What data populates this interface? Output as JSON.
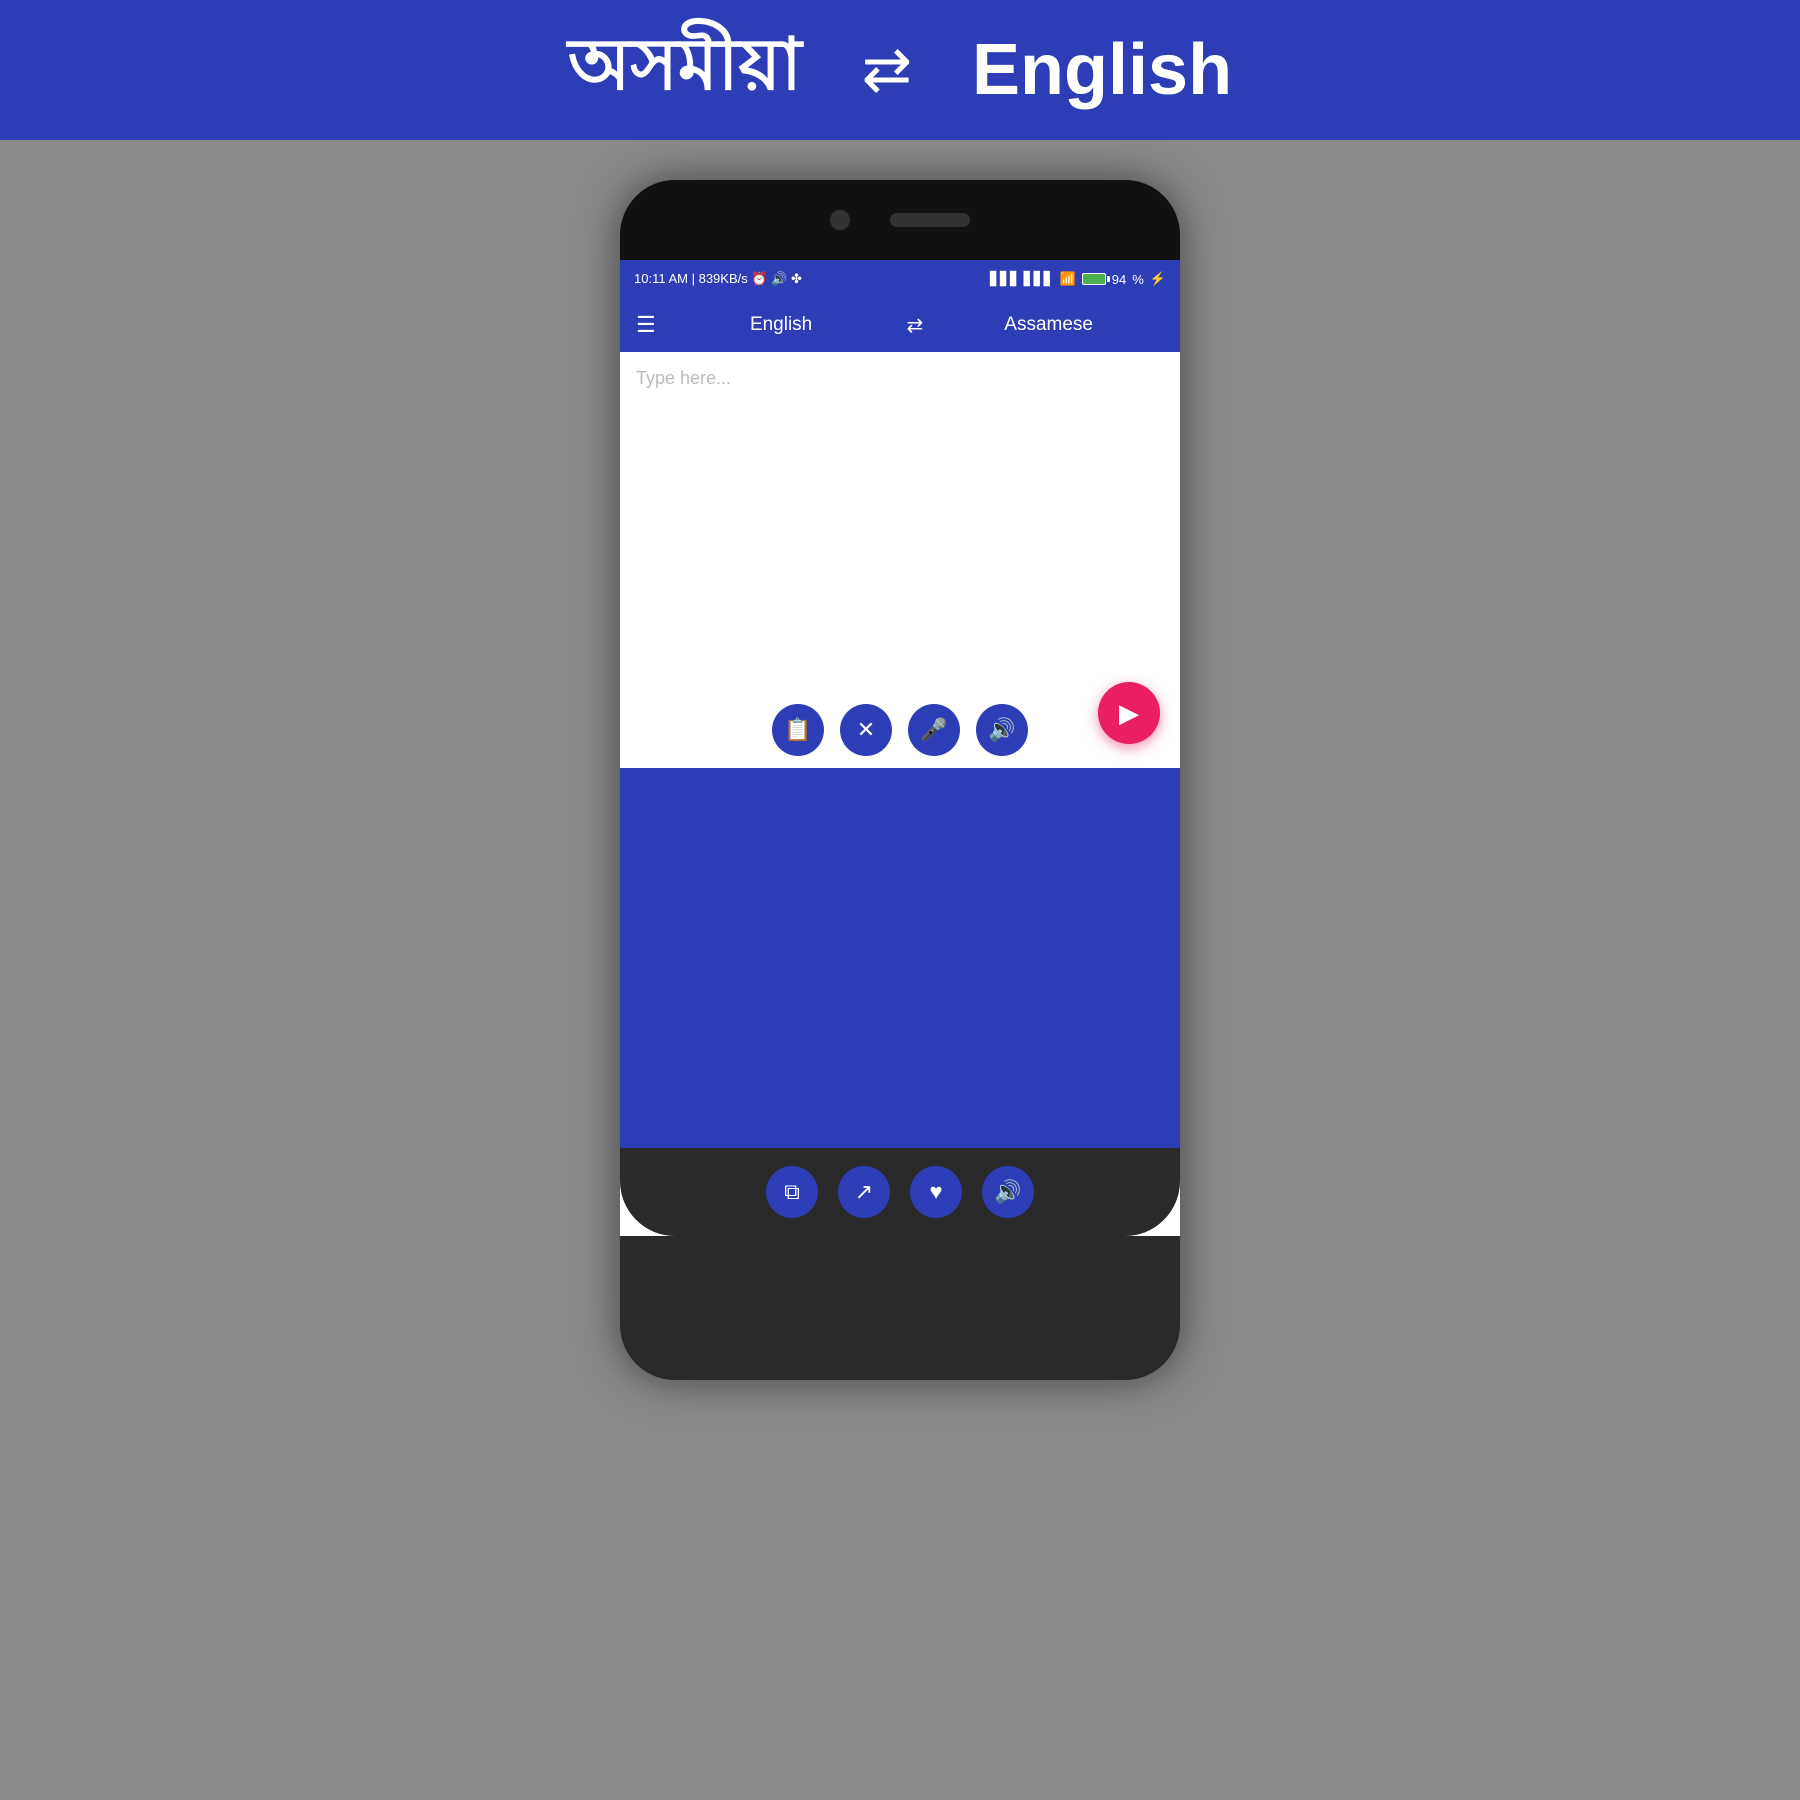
{
  "header": {
    "lang1": "অসমীয়া",
    "lang2": "English",
    "swap_icon": "⇄"
  },
  "status_bar": {
    "time": "10:11 AM",
    "data_speed": "839KB/s",
    "battery": "94"
  },
  "app_header": {
    "lang1": "English",
    "lang2": "Assamese",
    "swap_icon": "⇄"
  },
  "input": {
    "placeholder": "Type here..."
  },
  "buttons": {
    "clipboard": "📋",
    "close": "✕",
    "mic": "🎤",
    "speaker": "🔊",
    "send": "▶",
    "copy": "📋",
    "share": "↗",
    "heart": "♥",
    "speaker2": "🔊"
  },
  "labels": {
    "clipboard_label": "clipboard",
    "close_label": "close",
    "mic_label": "microphone",
    "speaker_label": "speaker",
    "send_label": "send",
    "copy_label": "copy",
    "share_label": "share",
    "heart_label": "favorite",
    "speaker2_label": "speaker-output"
  }
}
